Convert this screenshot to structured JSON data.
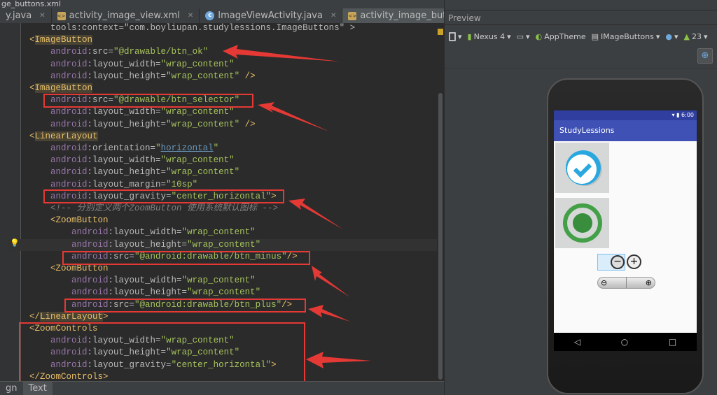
{
  "breadcrumb": "ge_buttons.xml",
  "tabs": [
    {
      "label": "y.java",
      "icon": "file-icon"
    },
    {
      "label": "activity_image_view.xml",
      "icon": "xml-file-icon"
    },
    {
      "label": "ImageViewActivity.java",
      "icon": "class-icon"
    },
    {
      "label": "activity_image_buttons.xml",
      "icon": "xml-file-icon",
      "active": true
    }
  ],
  "tab_overflow": "▾≡",
  "code_lines": [
    [
      [
        "attr",
        "        tools:context=\"com.boyliupan.studylessions.ImageButtons\" >"
      ]
    ],
    [
      [
        "tag",
        "    <"
      ],
      [
        "tagbg",
        "ImageButton"
      ]
    ],
    [
      [
        "attr",
        "        "
      ],
      [
        "ns",
        "android"
      ],
      [
        "attr",
        ":src="
      ],
      [
        "val",
        "\"@drawable/btn_ok\""
      ]
    ],
    [
      [
        "attr",
        "        "
      ],
      [
        "ns",
        "android"
      ],
      [
        "attr",
        ":layout_width="
      ],
      [
        "val",
        "\"wrap_content\""
      ]
    ],
    [
      [
        "attr",
        "        "
      ],
      [
        "ns",
        "android"
      ],
      [
        "attr",
        ":layout_height="
      ],
      [
        "val",
        "\"wrap_content\""
      ],
      [
        "tag",
        " />"
      ]
    ],
    [
      [
        "tag",
        "    <"
      ],
      [
        "tagbg",
        "ImageButton"
      ]
    ],
    [
      [
        "attr",
        "        "
      ],
      [
        "ns",
        "android"
      ],
      [
        "attr",
        ":src="
      ],
      [
        "val",
        "\"@drawable/btn_selector\""
      ]
    ],
    [
      [
        "attr",
        "        "
      ],
      [
        "ns",
        "android"
      ],
      [
        "attr",
        ":layout_width="
      ],
      [
        "val",
        "\"wrap_content\""
      ]
    ],
    [
      [
        "attr",
        "        "
      ],
      [
        "ns",
        "android"
      ],
      [
        "attr",
        ":layout_height="
      ],
      [
        "val",
        "\"wrap_content\""
      ],
      [
        "tag",
        " />"
      ]
    ],
    [
      [
        "tag",
        "    <"
      ],
      [
        "tagbg",
        "LinearLayout"
      ]
    ],
    [
      [
        "attr",
        "        "
      ],
      [
        "ns",
        "android"
      ],
      [
        "attr",
        ":orientation="
      ],
      [
        "val",
        "\""
      ],
      [
        "link",
        "horizontal"
      ],
      [
        "val",
        "\""
      ]
    ],
    [
      [
        "attr",
        "        "
      ],
      [
        "ns",
        "android"
      ],
      [
        "attr",
        ":layout_width="
      ],
      [
        "val",
        "\"wrap_content\""
      ]
    ],
    [
      [
        "attr",
        "        "
      ],
      [
        "ns",
        "android"
      ],
      [
        "attr",
        ":layout_height="
      ],
      [
        "val",
        "\"wrap_content\""
      ]
    ],
    [
      [
        "attr",
        "        "
      ],
      [
        "ns",
        "android"
      ],
      [
        "attr",
        ":layout_margin="
      ],
      [
        "val",
        "\"10sp\""
      ]
    ],
    [
      [
        "attr",
        "        "
      ],
      [
        "ns",
        "android"
      ],
      [
        "attr",
        ":layout_gravity="
      ],
      [
        "val",
        "\"center_horizontal\""
      ],
      [
        "tag",
        ">"
      ]
    ],
    [
      [
        "cm",
        "        <!-- 分别定义两个ZoomButton 使用系统默认图标 -->"
      ]
    ],
    [
      [
        "tag",
        "        <ZoomButton"
      ]
    ],
    [
      [
        "attr",
        "            "
      ],
      [
        "ns",
        "android"
      ],
      [
        "attr",
        ":layout_width="
      ],
      [
        "val",
        "\"wrap_content\""
      ]
    ],
    [
      [
        "attr",
        "            "
      ],
      [
        "ns",
        "android"
      ],
      [
        "attr",
        ":layout_height="
      ],
      [
        "val",
        "\"wrap_content\""
      ]
    ],
    [
      [
        "attr",
        "            "
      ],
      [
        "ns",
        "android"
      ],
      [
        "attr",
        ":src="
      ],
      [
        "val",
        "\"@android:drawable/btn_minus\""
      ],
      [
        "tag",
        "/>"
      ]
    ],
    [
      [
        "tag",
        "        <ZoomButton"
      ]
    ],
    [
      [
        "attr",
        "            "
      ],
      [
        "ns",
        "android"
      ],
      [
        "attr",
        ":layout_width="
      ],
      [
        "val",
        "\"wrap_content\""
      ]
    ],
    [
      [
        "attr",
        "            "
      ],
      [
        "ns",
        "android"
      ],
      [
        "attr",
        ":layout_height="
      ],
      [
        "val",
        "\"wrap_content\""
      ]
    ],
    [
      [
        "attr",
        "            "
      ],
      [
        "ns",
        "android"
      ],
      [
        "attr",
        ":src="
      ],
      [
        "val",
        "\"@android:drawable/btn_plus\""
      ],
      [
        "tag",
        "/>"
      ]
    ],
    [
      [
        "tag",
        "    </"
      ],
      [
        "tagbg",
        "LinearLayout"
      ],
      [
        "tag",
        ">"
      ]
    ],
    [
      [
        "tag",
        "    <ZoomControls"
      ]
    ],
    [
      [
        "attr",
        "        "
      ],
      [
        "ns",
        "android"
      ],
      [
        "attr",
        ":layout_width="
      ],
      [
        "val",
        "\"wrap_content\""
      ]
    ],
    [
      [
        "attr",
        "        "
      ],
      [
        "ns",
        "android"
      ],
      [
        "attr",
        ":layout_height="
      ],
      [
        "val",
        "\"wrap_content\""
      ]
    ],
    [
      [
        "attr",
        "        "
      ],
      [
        "ns",
        "android"
      ],
      [
        "attr",
        ":layout_gravity="
      ],
      [
        "val",
        "\"center_horizontal\""
      ],
      [
        "tag",
        ">"
      ]
    ],
    [
      [
        "tag",
        "    </ZoomControls>"
      ]
    ]
  ],
  "bottom_tabs": [
    "gn",
    "Text"
  ],
  "preview": {
    "title": "Preview",
    "toolbar": {
      "device": "Nexus 4",
      "theme": "AppTheme",
      "activity": "IMageButtons",
      "api": "23"
    },
    "phone": {
      "time": "6:00",
      "app_title": "StudyLessions"
    }
  },
  "colors": {
    "annotation": "#e53935",
    "app_bar": "#3f51b5"
  }
}
